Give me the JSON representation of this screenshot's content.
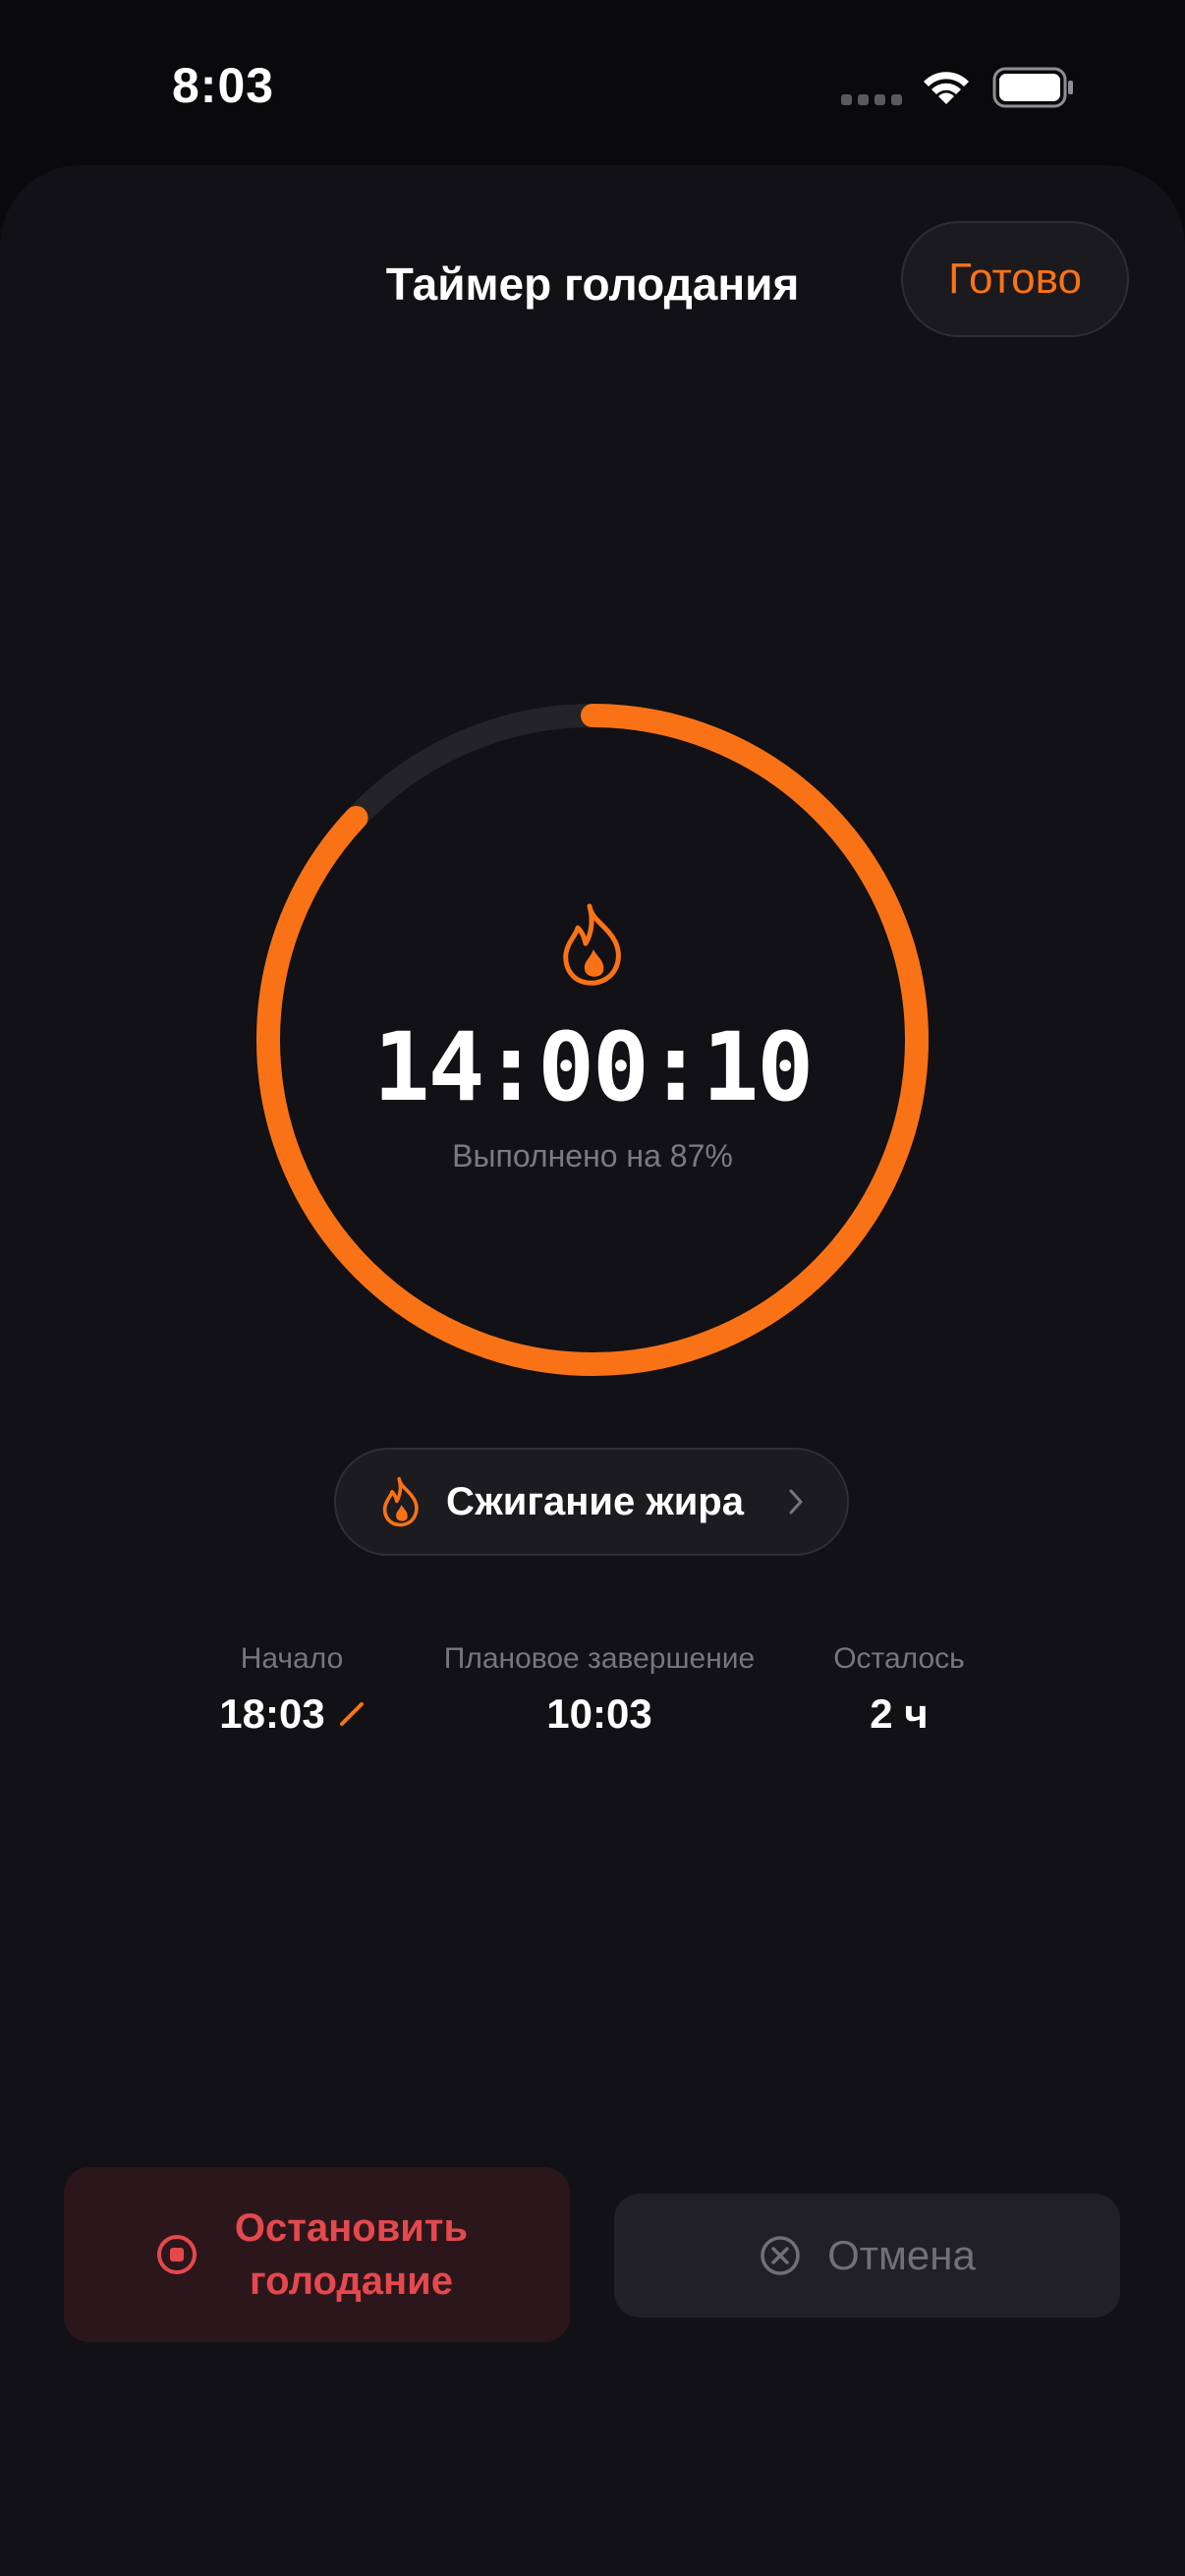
{
  "status_bar": {
    "time": "8:03"
  },
  "header": {
    "title": "Таймер голодания",
    "done_label": "Готово"
  },
  "timer": {
    "elapsed": "14:00:10",
    "progress_text": "Выполнено на 87%",
    "progress_percent": 87
  },
  "stage": {
    "label": "Сжигание жира"
  },
  "info": {
    "start_label": "Начало",
    "start_value": "18:03",
    "end_label": "Плановое завершение",
    "end_value": "10:03",
    "left_label": "Осталось",
    "left_value": "2 ч"
  },
  "actions": {
    "stop_label": "Остановить голодание",
    "cancel_label": "Отмена"
  },
  "colors": {
    "accent": "#f97316",
    "danger": "#e5484d",
    "track": "#242327"
  },
  "icons": {
    "timer_icon": "flame-icon",
    "stage_icon": "flame-icon",
    "edit_icon": "pencil-icon",
    "stop_icon": "stop-circle-icon",
    "cancel_icon": "x-circle-icon"
  }
}
